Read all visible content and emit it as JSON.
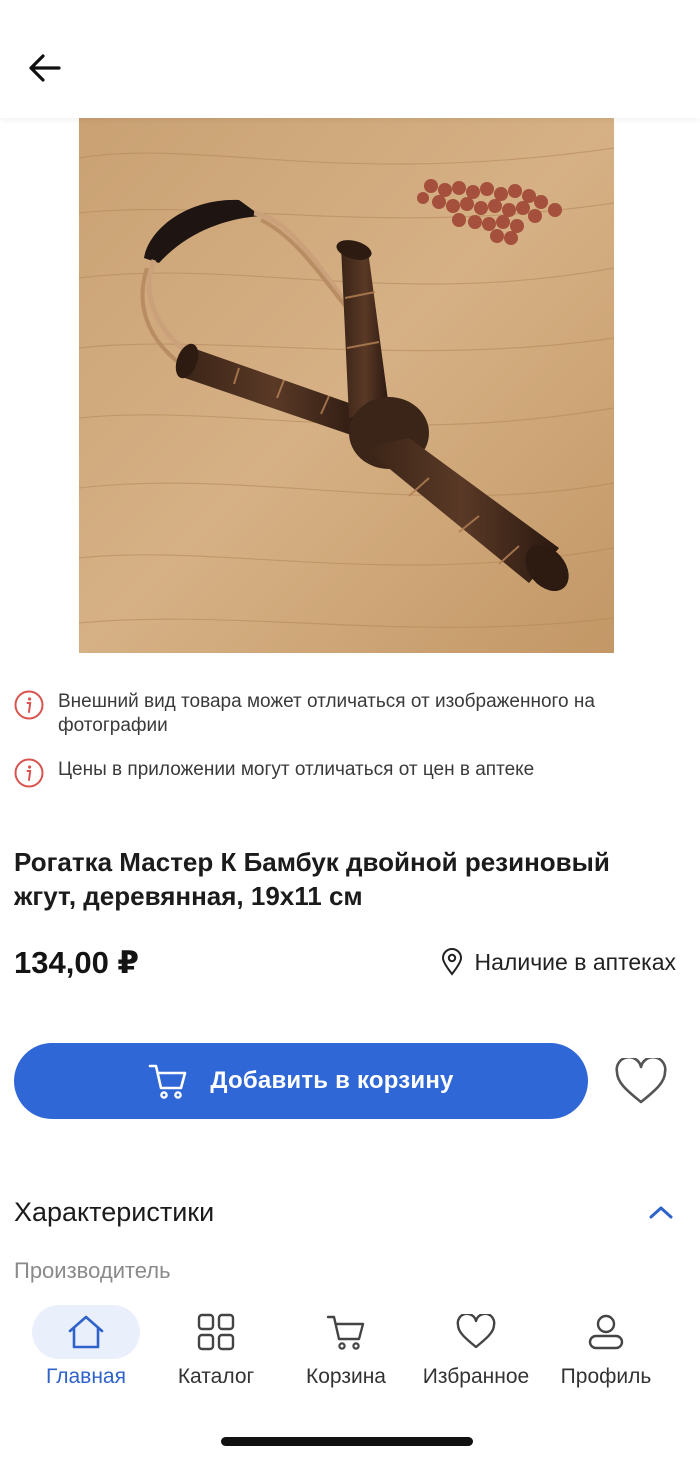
{
  "product": {
    "title": "Рогатка Мастер К Бамбук двойной резиновый жгут, деревянная, 19х11 см",
    "price": "134,00 ₽",
    "availability_label": "Наличие в аптеках",
    "add_to_cart_label": "Добавить в корзину"
  },
  "notices": [
    "Внешний вид товара может отличаться от изображенного на фотографии",
    "Цены в приложении могут отличаться от цен в аптеке"
  ],
  "specs": {
    "title": "Характеристики",
    "first_label": "Производитель"
  },
  "nav": {
    "items": [
      {
        "label": "Главная",
        "icon": "home-icon",
        "active": true
      },
      {
        "label": "Каталог",
        "icon": "grid-icon",
        "active": false
      },
      {
        "label": "Корзина",
        "icon": "cart-icon",
        "active": false
      },
      {
        "label": "Избранное",
        "icon": "heart-icon",
        "active": false
      },
      {
        "label": "Профиль",
        "icon": "profile-icon",
        "active": false
      }
    ]
  },
  "colors": {
    "accent": "#3067d6",
    "nav_active": "#2f63c9",
    "nav_active_bg": "#eaf0fb",
    "info_icon": "#d9534f"
  }
}
